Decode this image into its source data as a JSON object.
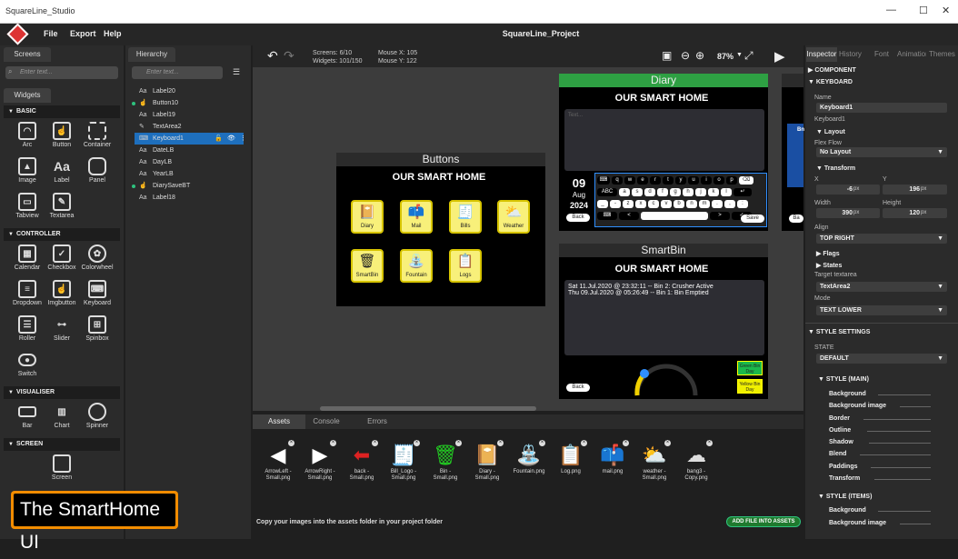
{
  "window": {
    "title": "SquareLine_Studio",
    "minimize": "—",
    "maximize": "☐",
    "close": "✕"
  },
  "menu": {
    "file": "File",
    "export": "Export",
    "help": "Help"
  },
  "app_title": "SquareLine_Project",
  "left": {
    "tab_screens": "Screens",
    "search_placeholder": "Enter text...",
    "tab_widgets": "Widgets",
    "sections": {
      "basic": "BASIC",
      "controller": "CONTROLLER",
      "visualiser": "VISUALISER",
      "screen": "SCREEN"
    },
    "basic": [
      "Arc",
      "Button",
      "Container",
      "Image",
      "Label",
      "Panel",
      "Tabview",
      "Textarea"
    ],
    "controller": [
      "Calendar",
      "Checkbox",
      "Colorwheel",
      "Dropdown",
      "Imgbutton",
      "Keyboard",
      "Roller",
      "Slider",
      "Spinbox",
      "Switch"
    ],
    "visualiser": [
      "Bar",
      "Chart",
      "Spinner"
    ],
    "screen": [
      "Screen"
    ]
  },
  "hierarchy": {
    "tab": "Hierarchy",
    "search_placeholder": "Enter text...",
    "items": [
      "Label20",
      "Button10",
      "Label19",
      "TextArea2",
      "Keyboard1",
      "DateLB",
      "DayLB",
      "YearLB",
      "DiarySaveBT",
      "Label18"
    ]
  },
  "toolbar": {
    "screens": "Screens: 6/10",
    "widgets": "Widgets: 101/150",
    "mouse_x": "Mouse X: 105",
    "mouse_y": "Mouse Y: 122",
    "zoom": "87%"
  },
  "buttons_screen": {
    "header": "Buttons",
    "title": "OUR SMART HOME",
    "tiles": [
      "Diary",
      "Mail",
      "Bills",
      "Weather",
      "SmartBin",
      "Fountain",
      "Logs"
    ]
  },
  "diary_screen": {
    "header": "Diary",
    "title": "OUR SMART HOME",
    "placeholder": "Text...",
    "day": "09",
    "month": "Aug",
    "year": "2024",
    "back": "Back",
    "save": "Save",
    "keys_row1": [
      "⌨",
      "q",
      "w",
      "e",
      "r",
      "t",
      "y",
      "u",
      "i",
      "o",
      "p",
      "⌫"
    ],
    "keys_row2": [
      "ABC",
      "a",
      "s",
      "d",
      "f",
      "g",
      "h",
      "j",
      "k",
      "l",
      "↵"
    ],
    "keys_row3": [
      "_",
      "-",
      "z",
      "x",
      "c",
      "v",
      "b",
      "n",
      "m",
      ".",
      ",",
      ":"
    ],
    "keys_row4": [
      "⌨",
      "<",
      "",
      ">",
      "✓"
    ]
  },
  "smartbin_screen": {
    "header": "SmartBin",
    "title": "OUR SMART HOME",
    "line1": "Sat 11.Jul.2020 @ 23:32:11 -- Bin 2: Crusher Active",
    "line2": "Thu 09.Jul.2020 @ 05:26:49 -- Bin 1: Bin Emptied",
    "back": "Back",
    "green": "Green Bin Day",
    "yellow": "Yellow Bin Day"
  },
  "right_screen": {
    "bn": "Bn",
    "back": "Ba"
  },
  "assets": {
    "tabs": [
      "Assets",
      "Console",
      "Errors"
    ],
    "items": [
      "ArrowLeft - Small.png",
      "ArrowRight - Small.png",
      "back - Small.png",
      "Bill_Logo - Small.png",
      "Bin - Small.png",
      "Diary - Small.png",
      "Fountain.png",
      "Log.png",
      "mail.png",
      "weather - Small.png",
      "bang3 - Copy.png"
    ],
    "hint": "Copy your images into the assets folder in your project folder",
    "add": "ADD FILE INTO ASSETS"
  },
  "inspector": {
    "tabs": [
      "Inspector",
      "History",
      "Font",
      "Animation",
      "Themes"
    ],
    "component": "COMPONENT",
    "keyboard": "KEYBOARD",
    "name_label": "Name",
    "name": "Keyboard1",
    "name2": "Keyboard1",
    "layout": "Layout",
    "flex_flow": "Flex Flow",
    "no_layout": "No Layout",
    "transform": "Transform",
    "x_label": "X",
    "y_label": "Y",
    "x": "-6",
    "x_unit": "px",
    "y": "196",
    "y_unit": "px",
    "w_label": "Width",
    "h_label": "Height",
    "w": "390",
    "w_unit": "px",
    "h": "120",
    "h_unit": "px",
    "align_label": "Align",
    "align": "TOP RIGHT",
    "flags": "Flags",
    "states": "States",
    "target_label": "Target textarea",
    "target": "TextArea2",
    "mode_label": "Mode",
    "mode": "TEXT LOWER",
    "style_settings": "STYLE SETTINGS",
    "state_label": "STATE",
    "state": "DEFAULT",
    "style_main": "STYLE (MAIN)",
    "main_items": [
      "Background",
      "Background image",
      "Border",
      "Outline",
      "Shadow",
      "Blend",
      "Paddings",
      "Transform"
    ],
    "style_items": "STYLE (ITEMS)",
    "items_items": [
      "Background",
      "Background image"
    ]
  },
  "badge": "The SmartHome UI"
}
